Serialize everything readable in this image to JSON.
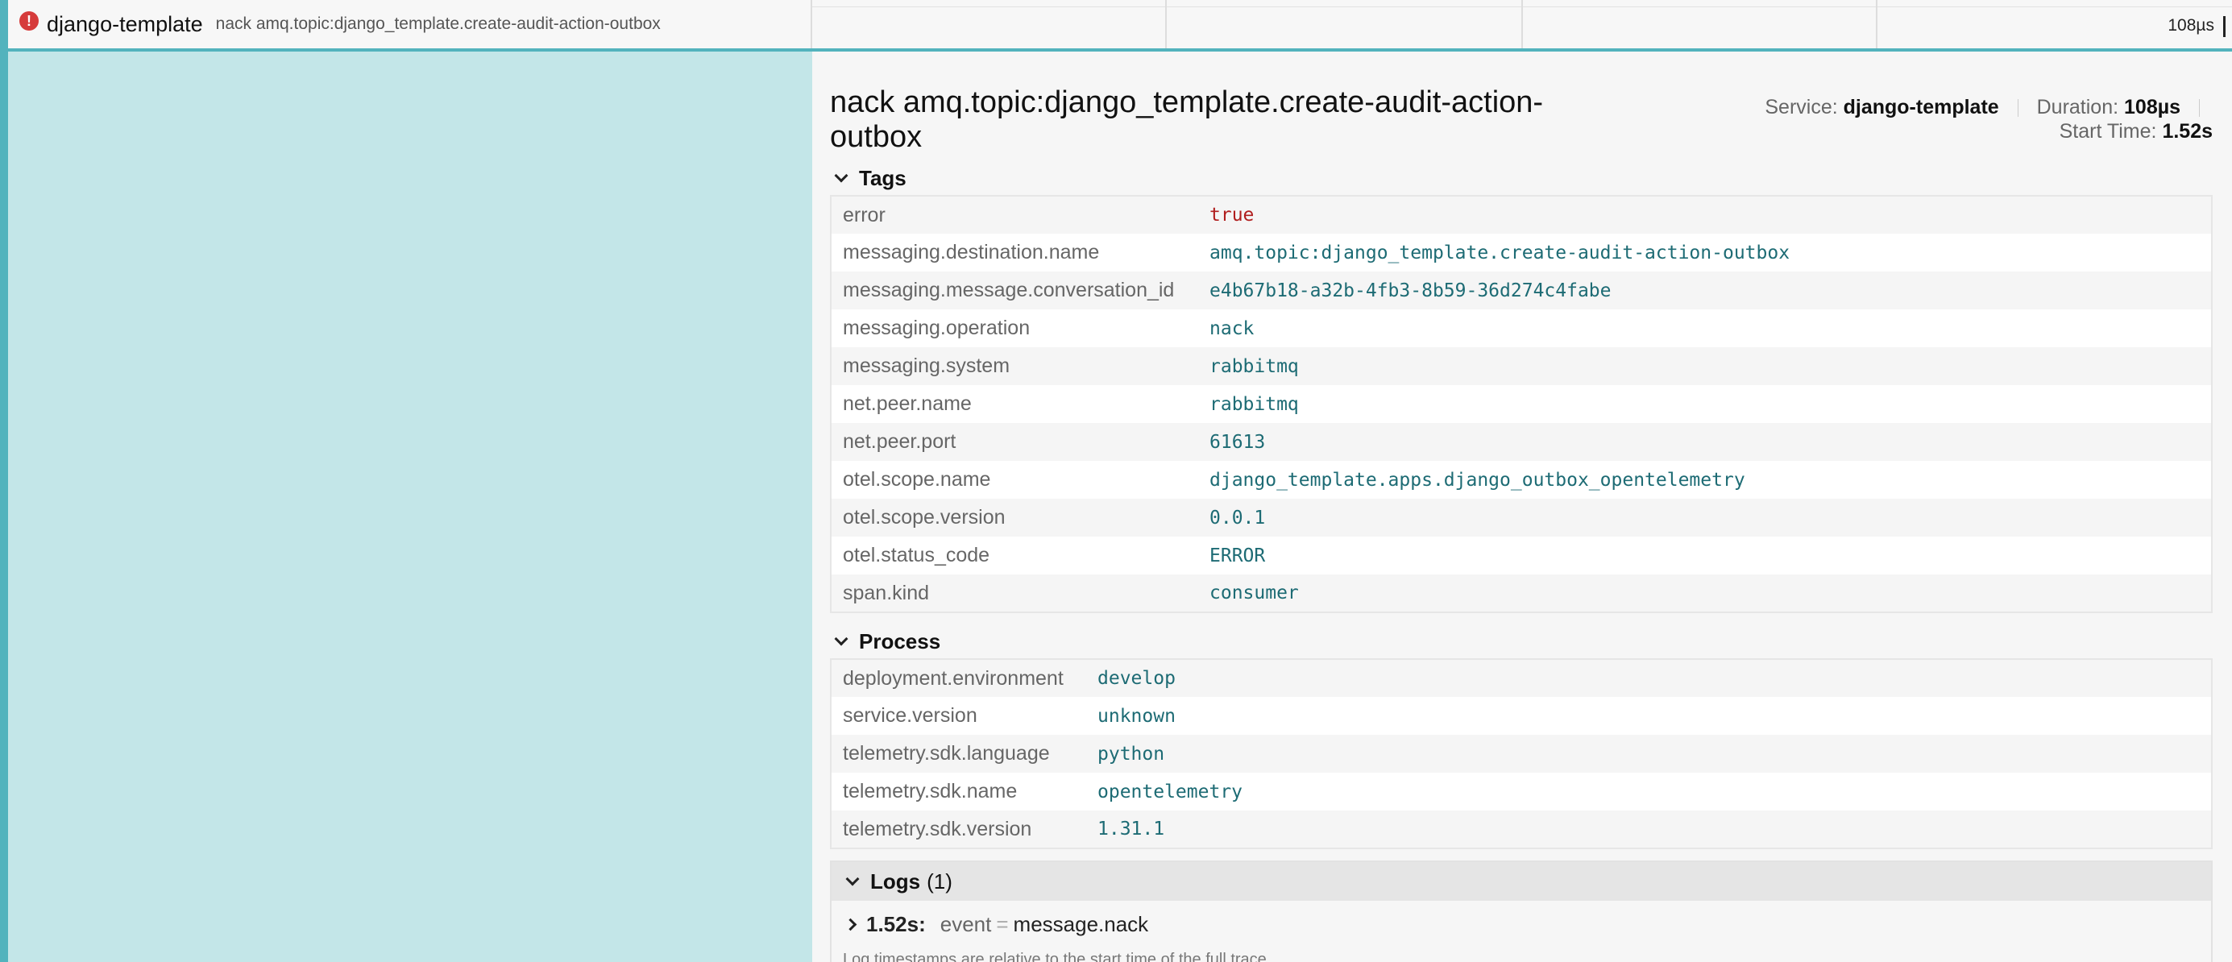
{
  "span_row": {
    "service": "django-template",
    "operation": "nack amq.topic:django_template.create-audit-action-outbox",
    "duration": "108µs"
  },
  "detail": {
    "title": "nack amq.topic:django_template.create-audit-action-outbox",
    "service_label": "Service:",
    "service_value": "django-template",
    "duration_label": "Duration:",
    "duration_value": "108µs",
    "start_label": "Start Time:",
    "start_value": "1.52s"
  },
  "tags": {
    "heading": "Tags",
    "rows": [
      {
        "key": "error",
        "value": "true"
      },
      {
        "key": "messaging.destination.name",
        "value": "amq.topic:django_template.create-audit-action-outbox"
      },
      {
        "key": "messaging.message.conversation_id",
        "value": "e4b67b18-a32b-4fb3-8b59-36d274c4fabe"
      },
      {
        "key": "messaging.operation",
        "value": "nack"
      },
      {
        "key": "messaging.system",
        "value": "rabbitmq"
      },
      {
        "key": "net.peer.name",
        "value": "rabbitmq"
      },
      {
        "key": "net.peer.port",
        "value": "61613"
      },
      {
        "key": "otel.scope.name",
        "value": "django_template.apps.django_outbox_opentelemetry"
      },
      {
        "key": "otel.scope.version",
        "value": "0.0.1"
      },
      {
        "key": "otel.status_code",
        "value": "ERROR"
      },
      {
        "key": "span.kind",
        "value": "consumer"
      }
    ]
  },
  "process": {
    "heading": "Process",
    "rows": [
      {
        "key": "deployment.environment",
        "value": "develop"
      },
      {
        "key": "service.version",
        "value": "unknown"
      },
      {
        "key": "telemetry.sdk.language",
        "value": "python"
      },
      {
        "key": "telemetry.sdk.name",
        "value": "opentelemetry"
      },
      {
        "key": "telemetry.sdk.version",
        "value": "1.31.1"
      }
    ]
  },
  "logs": {
    "heading": "Logs",
    "count": "(1)",
    "entry_time": "1.52s:",
    "entry_key": "event",
    "entry_eq": "=",
    "entry_value": "message.nack",
    "note": "Log timestamps are relative to the start time of the full trace."
  },
  "colors": {
    "accent": "#52b3bd",
    "span_bg": "#c3e6e8",
    "error": "#d63b3b",
    "value_text": "#1d6b74"
  }
}
